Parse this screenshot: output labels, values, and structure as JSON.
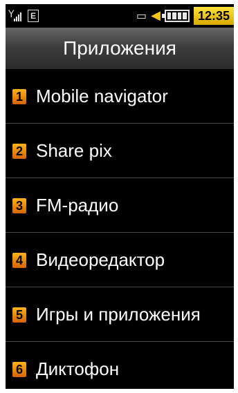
{
  "status_bar": {
    "network_label": "E",
    "time": "12:35",
    "battery_level": 1.0,
    "signal_level": 1.0
  },
  "header": {
    "title": "Приложения"
  },
  "menu": {
    "items": [
      {
        "number": "1",
        "label": "Mobile navigator"
      },
      {
        "number": "2",
        "label": "Share pix"
      },
      {
        "number": "3",
        "label": "FM-радио"
      },
      {
        "number": "4",
        "label": "Видеоредактор"
      },
      {
        "number": "5",
        "label": "Игры и приложения"
      },
      {
        "number": "6",
        "label": "Диктофон"
      }
    ]
  },
  "colors": {
    "background": "#000000",
    "number_badge": "#f28a10",
    "clock_bg": "#f2cf1f",
    "speaker": "#f6c21a",
    "text": "#ffffff"
  }
}
